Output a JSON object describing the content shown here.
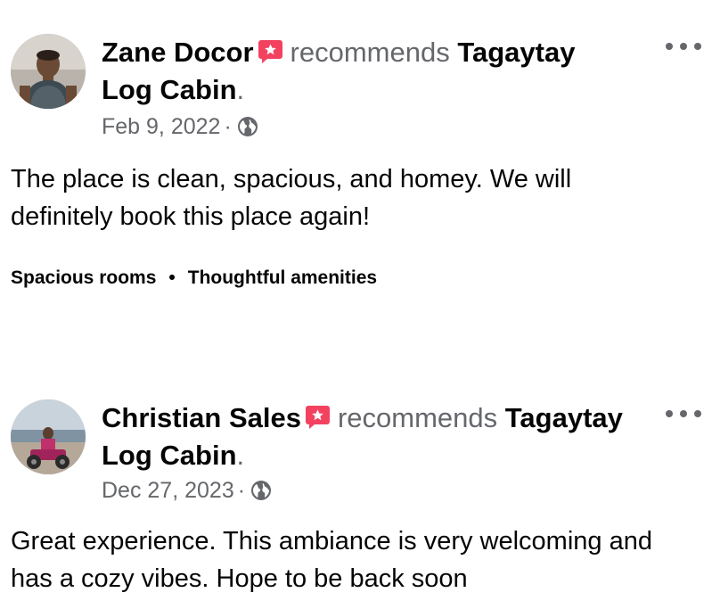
{
  "reviews": [
    {
      "author": "Zane Docor",
      "recommends_word": "recommends",
      "place": "Tagaytay Log Cabin",
      "period": ".",
      "date": "Feb 9, 2022",
      "date_separator": "·",
      "text": "The place is clean, spacious, and homey. We will definitely book this place again!",
      "tags": [
        "Spacious rooms",
        "Thoughtful amenities"
      ],
      "tag_separator": "•"
    },
    {
      "author": "Christian Sales",
      "recommends_word": "recommends",
      "place": "Tagaytay Log Cabin",
      "period": ".",
      "date": "Dec 27, 2023",
      "date_separator": "·",
      "text": "Great experience. This ambiance is very welcoming and has a cozy vibes. Hope to be back soon"
    }
  ],
  "icons": {
    "recommend_badge": "recommend-badge-icon",
    "privacy": "globe-icon",
    "more": "more-options-icon"
  },
  "colors": {
    "badge": "#f3425f",
    "text_primary": "#050505",
    "text_secondary": "#65676b"
  }
}
